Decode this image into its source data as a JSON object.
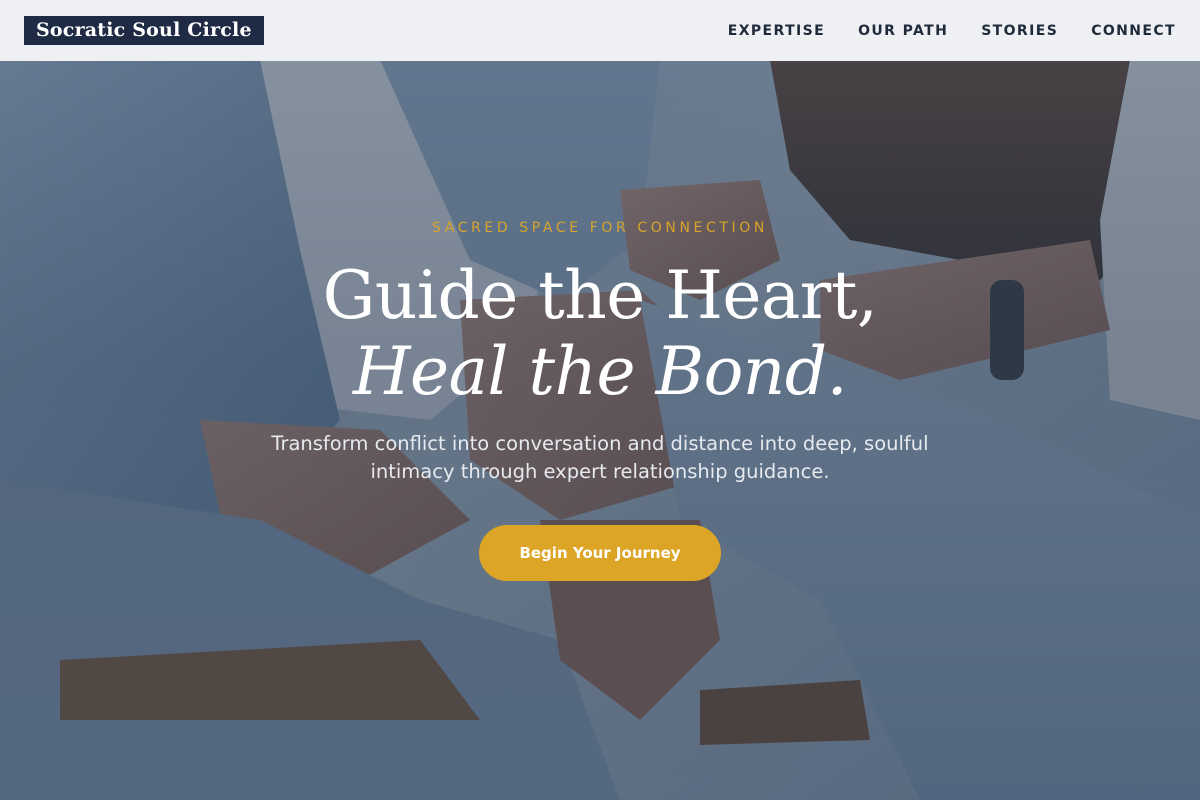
{
  "brand": {
    "logo_text": "Socratic Soul Circle",
    "logo_bg": "#1f2a44"
  },
  "nav": {
    "items": [
      {
        "label": "EXPERTISE"
      },
      {
        "label": "OUR PATH"
      },
      {
        "label": "STORIES"
      },
      {
        "label": "CONNECT"
      }
    ]
  },
  "hero": {
    "eyebrow": "SACRED SPACE FOR CONNECTION",
    "headline_line1": "Guide the Heart,",
    "headline_line2": "Heal the Bond.",
    "subtitle": "Transform conflict into conversation and distance into deep, soulful intimacy through expert relationship guidance.",
    "cta_label": "Begin Your Journey",
    "background_image": "couple-sitting-in-denim-photo"
  },
  "colors": {
    "accent": "#dca526",
    "eyebrow": "#d8a42a",
    "nav_text": "#1f2a3a",
    "overlay": "#283a52"
  }
}
